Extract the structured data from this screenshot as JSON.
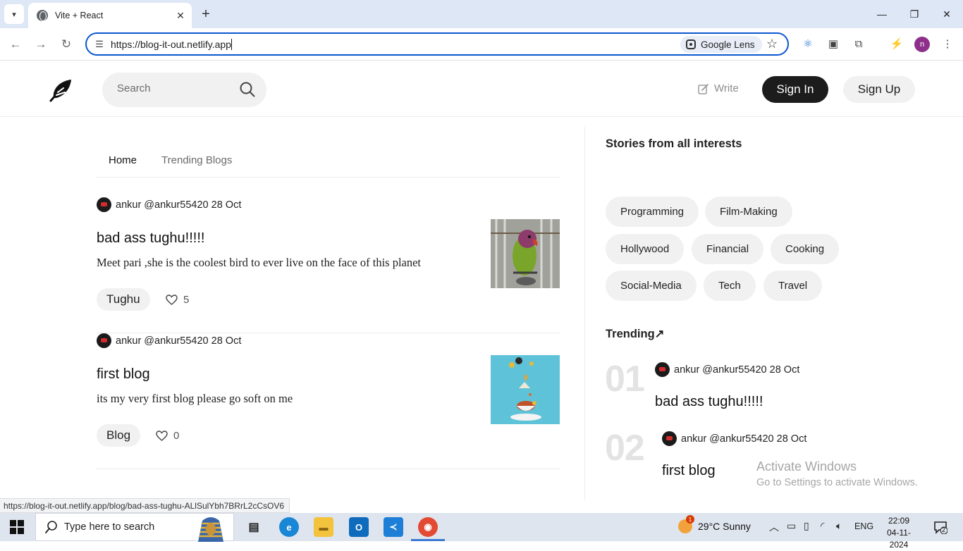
{
  "browser": {
    "tab_title": "Vite + React",
    "url": "https://blog-it-out.netlify.app",
    "lens_label": "Google Lens",
    "profile_initial": "n",
    "status_link": "https://blog-it-out.netlify.app/blog/bad-ass-tughu-ALlSulYbh7BRrL2cCsOV6"
  },
  "header": {
    "search_placeholder": "Search",
    "write_label": "Write",
    "signin_label": "Sign In",
    "signup_label": "Sign Up"
  },
  "feed": {
    "tabs": [
      "Home",
      "Trending Blogs"
    ],
    "posts": [
      {
        "author": "ankur @ankur55420 28 Oct",
        "title": "bad ass tughu!!!!!",
        "description": "Meet pari ,she is the coolest bird to ever live on the face of this planet",
        "tag": "Tughu",
        "likes": "5"
      },
      {
        "author": "ankur @ankur55420 28 Oct",
        "title": "first blog",
        "description": "its my very first blog please go soft on me",
        "tag": "Blog",
        "likes": "0"
      }
    ]
  },
  "sidebar": {
    "title": "Stories from all interests",
    "topics": [
      "Programming",
      "Film-Making",
      "Hollywood",
      "Financial",
      "Cooking",
      "Social-Media",
      "Tech",
      "Travel"
    ],
    "trending_title": "Trending↗",
    "trending": [
      {
        "number": "01",
        "author": "ankur @ankur55420 28 Oct",
        "title": "bad ass tughu!!!!!"
      },
      {
        "number": "02",
        "author": "ankur @ankur55420 28 Oct",
        "title": "first blog"
      }
    ]
  },
  "watermark": {
    "line1": "Activate Windows",
    "line2": "Go to Settings to activate Windows."
  },
  "taskbar": {
    "search_placeholder": "Type here to search",
    "weather_badge": "1",
    "weather": "29°C  Sunny",
    "language": "ENG",
    "time": "22:09",
    "date": "04-11-2024",
    "notifications": "2"
  }
}
